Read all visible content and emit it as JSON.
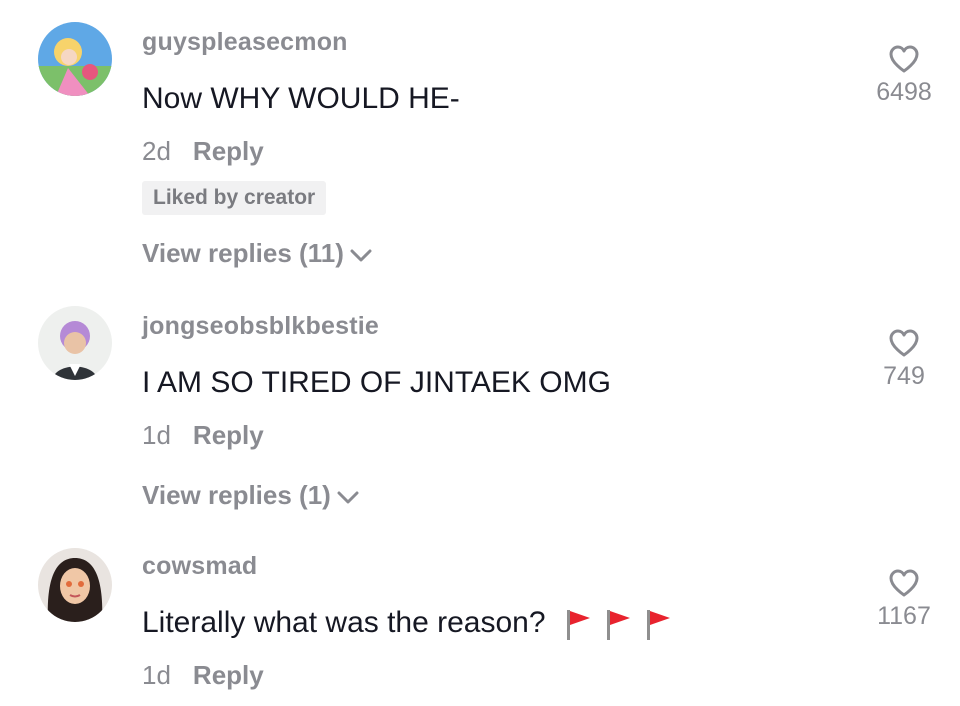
{
  "comments": [
    {
      "username": "guyspleasecmon",
      "text": "Now WHY WOULD HE-",
      "age": "2d",
      "reply_label": "Reply",
      "badge": "Liked by creator",
      "view_replies": "View replies (11)",
      "likes": "6498"
    },
    {
      "username": "jongseobsblkbestie",
      "text": "I AM SO TIRED OF JINTAEK OMG",
      "age": "1d",
      "reply_label": "Reply",
      "view_replies": "View replies (1)",
      "likes": "749"
    },
    {
      "username": "cowsmad",
      "text": "Literally what was the reason?",
      "emoji": [
        "red-flag",
        "red-flag",
        "red-flag"
      ],
      "age": "1d",
      "reply_label": "Reply",
      "likes": "1167"
    }
  ],
  "colors": {
    "text_primary": "#161823",
    "text_secondary": "#8a8b91",
    "badge_bg": "#f1f1f2",
    "flag_red": "#e8232e"
  }
}
